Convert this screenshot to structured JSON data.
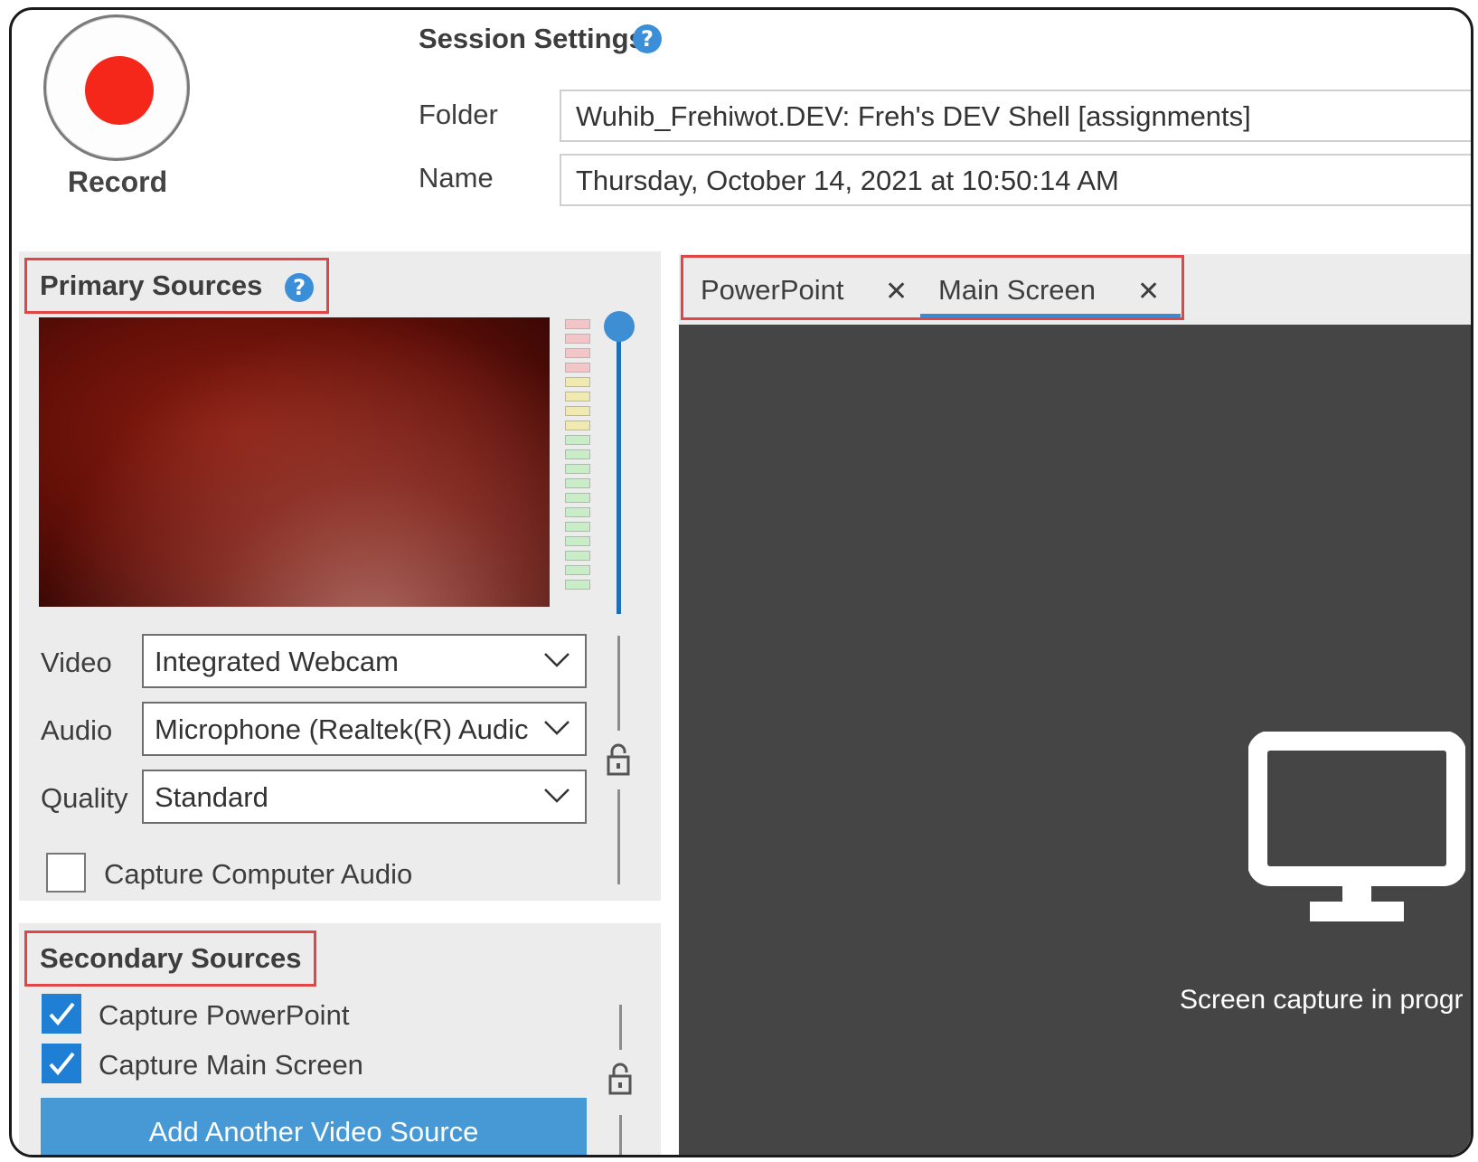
{
  "record": {
    "label": "Record"
  },
  "session": {
    "title": "Session Settings",
    "folder_label": "Folder",
    "folder_value": "Wuhib_Frehiwot.DEV: Freh's DEV Shell [assignments]",
    "name_label": "Name",
    "name_value": "Thursday, October 14, 2021 at 10:50:14 AM"
  },
  "primary": {
    "title": "Primary Sources",
    "video_label": "Video",
    "video_value": "Integrated Webcam",
    "audio_label": "Audio",
    "audio_value": "Microphone (Realtek(R) Audic",
    "quality_label": "Quality",
    "quality_value": "Standard",
    "capture_audio_label": "Capture Computer Audio",
    "capture_audio_checked": false,
    "volume_level": 1.0
  },
  "secondary": {
    "title": "Secondary Sources",
    "capture_powerpoint_label": "Capture PowerPoint",
    "capture_powerpoint_checked": true,
    "capture_main_screen_label": "Capture Main Screen",
    "capture_main_screen_checked": true,
    "add_source_label": "Add Another Video Source"
  },
  "tabs": [
    {
      "label": "PowerPoint",
      "active": false
    },
    {
      "label": "Main Screen",
      "active": true
    }
  ],
  "preview": {
    "status_text": "Screen capture in progr"
  },
  "colors": {
    "record_red": "#f5271a",
    "accent_blue": "#3a8bd2",
    "highlight_red": "#e04646",
    "preview_dark": "#454545"
  },
  "icons": {
    "help": "help-icon",
    "close": "close-icon",
    "lock": "lock-icon",
    "monitor": "monitor-icon",
    "chevron": "chevron-down-icon",
    "check": "checkmark-icon"
  }
}
